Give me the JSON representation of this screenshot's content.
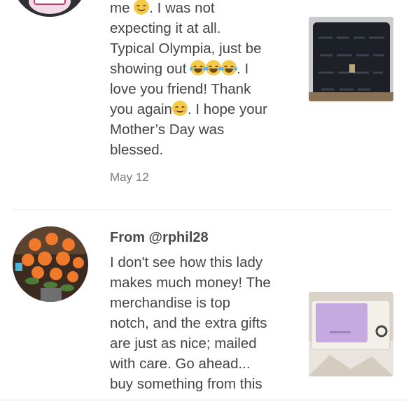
{
  "review1": {
    "avatar_icon": "character-avatar-icon",
    "lines": [
      "me",
      ". I was not",
      "expecting it at all.",
      "Typical Olympia, just be",
      "showing out",
      ". I",
      "love you friend! Thank",
      "you again",
      ". I hope your",
      "Mother’s Day was",
      "blessed."
    ],
    "date": "May 12",
    "thumbnail_icon": "black-embossed-tote-bag-photo"
  },
  "review2": {
    "avatar_icon": "orange-roses-bouquet-avatar",
    "from": "From @rphil28",
    "lines": [
      "I don't see how this lady",
      "makes much money! The",
      "merchandise is top",
      "notch, and the extra gifts",
      "are just as nice; mailed",
      "with care. Go ahead...",
      "buy something from this"
    ],
    "thumbnail_icon": "lilac-wallet-photo"
  },
  "colors": {
    "text": "#444444",
    "date": "#7a7a7a",
    "divider": "#e6e6e6",
    "emoji": "#f7c948"
  }
}
